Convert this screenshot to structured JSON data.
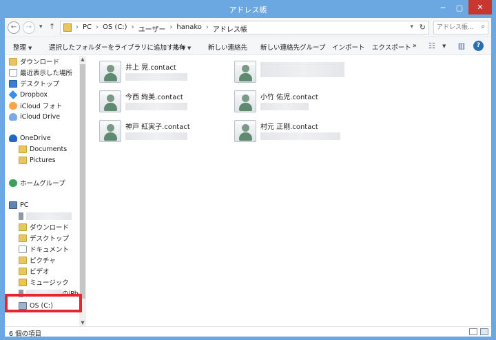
{
  "window": {
    "title": "アドレス帳",
    "minimize": "─",
    "maximize": "▢",
    "close": "✕"
  },
  "address": {
    "back": "←",
    "forward": "→",
    "recent": "▾",
    "up": "↑",
    "crumbs": [
      "PC",
      "OS (C:)",
      "ユーザー",
      "hanako",
      "アドレス帳"
    ],
    "separator": "›",
    "dropdown": "▾",
    "refresh": "↻",
    "search_placeholder": "アドレス帳...",
    "search_icon": "⌕"
  },
  "toolbar": {
    "organize": "整理",
    "add_to_library": "選択したフォルダーをライブラリに追加する",
    "share": "共有",
    "new_contact": "新しい連絡先",
    "new_contact_group": "新しい連絡先グループ",
    "import": "インポート",
    "export": "エクスポート",
    "more": "»",
    "dropdown": "▼",
    "help": "?"
  },
  "nav": {
    "favorites": [
      {
        "label": "ダウンロード",
        "icon": "downloads-folder-icon"
      },
      {
        "label": "最近表示した場所",
        "icon": "recent-places-icon"
      },
      {
        "label": "デスクトップ",
        "icon": "desktop-icon"
      },
      {
        "label": "Dropbox",
        "icon": "dropbox-icon"
      },
      {
        "label": "iCloud フォト",
        "icon": "icloud-photos-icon"
      },
      {
        "label": "iCloud Drive",
        "icon": "icloud-drive-icon"
      }
    ],
    "onedrive": {
      "label": "OneDrive",
      "children": [
        "Documents",
        "Pictures"
      ]
    },
    "homegroup": "ホームグループ",
    "pc": {
      "label": "PC",
      "children": [
        "ダウンロード",
        "デスクトップ",
        "ドキュメント",
        "ピクチャ",
        "ビデオ",
        "ミュージック"
      ],
      "iphone_suffix": "のiPho",
      "os_drive": "OS (C:)"
    },
    "scroll_up": "▲",
    "scroll_down": "▼"
  },
  "contacts": [
    {
      "name": "井上 晃.contact"
    },
    {
      "name": ""
    },
    {
      "name": "今西 絢美.contact"
    },
    {
      "name": "小竹 佑児.contact"
    },
    {
      "name": "神戸 紅実子.contact"
    },
    {
      "name": "村元 正剛.contact"
    }
  ],
  "status": {
    "item_count": "6 個の項目"
  },
  "colors": {
    "titlebar": "#6ba7e0",
    "highlight": "#e8242f",
    "close": "#c7372f"
  }
}
